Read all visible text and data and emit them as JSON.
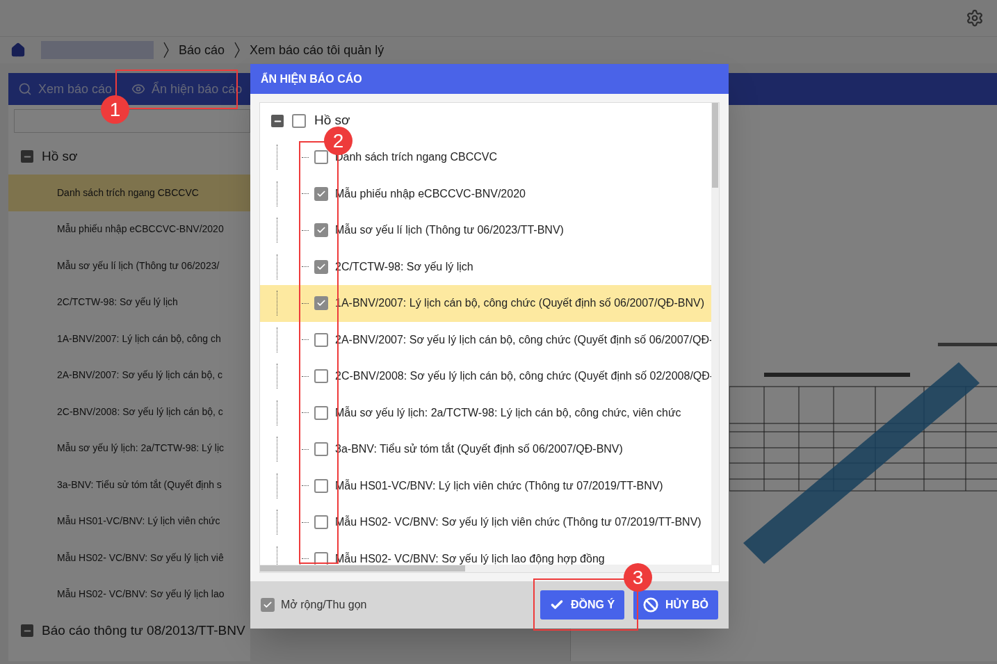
{
  "breadcrumb": [
    "Báo cáo",
    "Xem báo cáo tôi quản lý"
  ],
  "tabs": [
    {
      "label": "Xem báo cáo",
      "selected": false
    },
    {
      "label": "Ẩn hiện báo cáo",
      "selected": false
    }
  ],
  "sidebar": {
    "groups": [
      {
        "label": "Hồ sơ",
        "expanded": true,
        "items": [
          {
            "label": "Danh sách trích ngang CBCCVC",
            "selected": true
          },
          {
            "label": "Mẫu phiếu nhập eCBCCVC-BNV/2020",
            "selected": false
          },
          {
            "label": "Mẫu sơ yếu lí lịch (Thông tư 06/2023/",
            "selected": false
          },
          {
            "label": "2C/TCTW-98: Sơ yếu lý lịch",
            "selected": false
          },
          {
            "label": "1A-BNV/2007: Lý lịch cán bộ, công ch",
            "selected": false
          },
          {
            "label": "2A-BNV/2007: Sơ yếu lý lịch cán bộ, c",
            "selected": false
          },
          {
            "label": "2C-BNV/2008: Sơ yếu lý lịch cán bộ, c",
            "selected": false
          },
          {
            "label": "Mẫu sơ yếu lý lịch: 2a/TCTW-98: Lý lịc",
            "selected": false
          },
          {
            "label": "3a-BNV: Tiểu sử tóm tắt (Quyết định s",
            "selected": false
          },
          {
            "label": "Mẫu HS01-VC/BNV: Lý lịch viên chức",
            "selected": false
          },
          {
            "label": "Mẫu HS02- VC/BNV: Sơ yếu lý lịch viê",
            "selected": false
          },
          {
            "label": "Mẫu HS02- VC/BNV: Sơ yếu lý lịch lao",
            "selected": false
          }
        ]
      },
      {
        "label": "Báo cáo thông tư 08/2013/TT-BNV",
        "expanded": true
      }
    ]
  },
  "preview": {
    "kind": "picture"
  },
  "dialog": {
    "title": "ẨN HIỆN BÁO CÁO",
    "tree": {
      "label": "Hồ sơ",
      "expanded": true,
      "checked": false,
      "children": [
        {
          "label": "Danh sách trích ngang CBCCVC",
          "checked": false,
          "selected": false
        },
        {
          "label": "Mẫu phiếu nhập eCBCCVC-BNV/2020",
          "checked": true,
          "selected": false
        },
        {
          "label": "Mẫu sơ yếu lí lịch (Thông tư 06/2023/TT-BNV)",
          "checked": true,
          "selected": false
        },
        {
          "label": "2C/TCTW-98: Sơ yếu lý lịch",
          "checked": true,
          "selected": false
        },
        {
          "label": "1A-BNV/2007: Lý lịch cán bộ, công chức (Quyết định số 06/2007/QĐ-BNV)",
          "checked": true,
          "selected": true
        },
        {
          "label": "2A-BNV/2007: Sơ yếu lý lịch cán bộ, công chức (Quyết định số 06/2007/QĐ-",
          "checked": false,
          "selected": false
        },
        {
          "label": "2C-BNV/2008: Sơ yếu lý lịch cán bộ, công chức (Quyết định số 02/2008/QĐ-",
          "checked": false,
          "selected": false
        },
        {
          "label": "Mẫu sơ yếu lý lịch: 2a/TCTW-98: Lý lịch cán bộ, công chức, viên chức",
          "checked": false,
          "selected": false
        },
        {
          "label": "3a-BNV: Tiểu sử tóm tắt (Quyết định số 06/2007/QĐ-BNV)",
          "checked": false,
          "selected": false
        },
        {
          "label": "Mẫu HS01-VC/BNV: Lý lịch viên chức (Thông tư 07/2019/TT-BNV)",
          "checked": false,
          "selected": false
        },
        {
          "label": "Mẫu HS02- VC/BNV: Sơ yếu lý lịch viên chức (Thông tư 07/2019/TT-BNV)",
          "checked": false,
          "selected": false
        },
        {
          "label": "Mẫu HS02- VC/BNV: Sơ yếu lý lịch lao động hợp đồng",
          "checked": false,
          "selected": false
        }
      ]
    },
    "expand_toggle": {
      "label": "Mở rộng/Thu gọn",
      "checked": true
    },
    "buttons": [
      {
        "label": "ĐỒNG Ý",
        "kind": "confirm"
      },
      {
        "label": "HỦY BỎ",
        "kind": "cancel"
      }
    ]
  },
  "annotations": [
    "1",
    "2",
    "3"
  ]
}
